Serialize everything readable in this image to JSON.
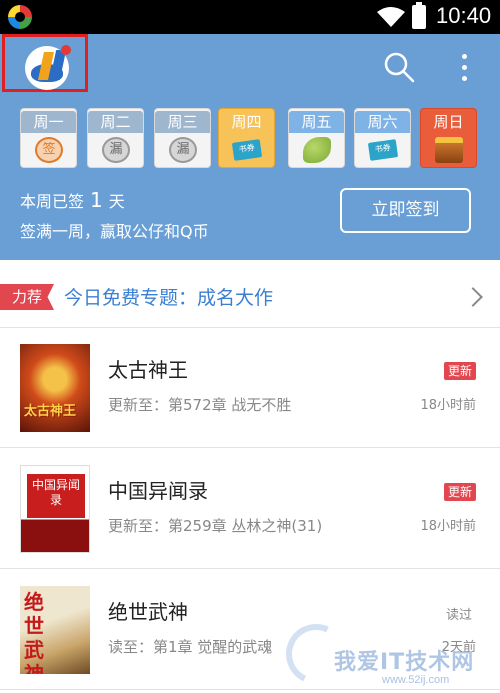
{
  "status_bar": {
    "time": "10:40",
    "icons": [
      "app-badge-icon",
      "wifi-icon",
      "battery-icon"
    ]
  },
  "header": {
    "logo_icon": "app-logo-icon",
    "search_icon": "search-icon",
    "menu_icon": "more-vertical-icon",
    "background_color": "#6a9fd6"
  },
  "checkin": {
    "days": [
      {
        "label": "周一",
        "state": "signed",
        "mark_text": "签"
      },
      {
        "label": "周二",
        "state": "missed",
        "mark_text": "漏"
      },
      {
        "label": "周三",
        "state": "missed",
        "mark_text": "漏"
      },
      {
        "label": "周四",
        "state": "today",
        "mark_text": "书券"
      },
      {
        "label": "周五",
        "state": "future",
        "mark_text": ""
      },
      {
        "label": "周六",
        "state": "future",
        "mark_text": "书券"
      },
      {
        "label": "周日",
        "state": "future",
        "mark_text": ""
      }
    ],
    "signed_prefix": "本周已签",
    "signed_count": "1",
    "signed_suffix": "天",
    "reward_text": "签满一周，赢取公仔和Q币",
    "sign_button": "立即签到"
  },
  "recommend": {
    "tag": "力荐",
    "title": "今日免费专题：成名大作"
  },
  "books": [
    {
      "title": "太古神王",
      "cover_text": "太古神王",
      "progress": "更新至：第572章 战无不胜",
      "badge": "更新",
      "time": "18小时前"
    },
    {
      "title": "中国异闻录",
      "cover_text": "中国异闻录",
      "progress": "更新至：第259章 丛林之神(31)",
      "badge": "更新",
      "time": "18小时前"
    },
    {
      "title": "绝世武神",
      "cover_text": "绝世武神",
      "progress": "读至：第1章 觉醒的武魂",
      "badge": "读过",
      "time": "2天前"
    }
  ],
  "watermark": {
    "text": "我爱IT技术网",
    "url": "www.52ij.com"
  }
}
